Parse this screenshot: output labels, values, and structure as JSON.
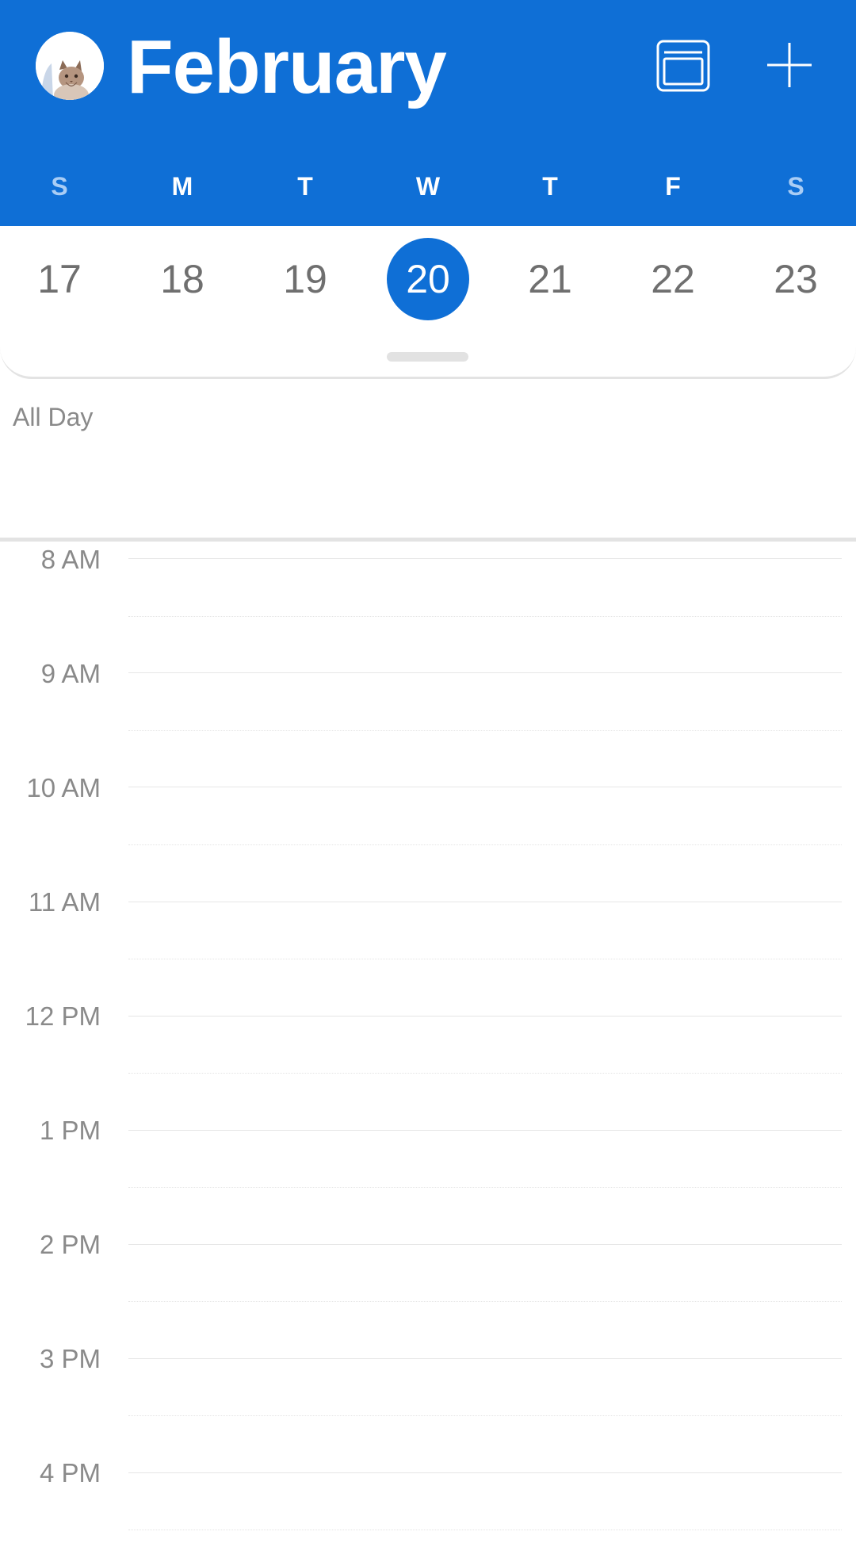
{
  "header": {
    "month_title": "February",
    "brand_color": "#0f6fd6",
    "icons": {
      "avatar": "avatar-cat-photo",
      "view": "calendar-view-icon",
      "add": "plus-icon"
    }
  },
  "weekdays": [
    "S",
    "M",
    "T",
    "W",
    "T",
    "F",
    "S"
  ],
  "dates": [
    "17",
    "18",
    "19",
    "20",
    "21",
    "22",
    "23"
  ],
  "selected_date": "20",
  "all_day_label": "All Day",
  "hours": [
    "8 AM",
    "9 AM",
    "10 AM",
    "11 AM",
    "12 PM",
    "1 PM",
    "2 PM",
    "3 PM",
    "4 PM"
  ]
}
